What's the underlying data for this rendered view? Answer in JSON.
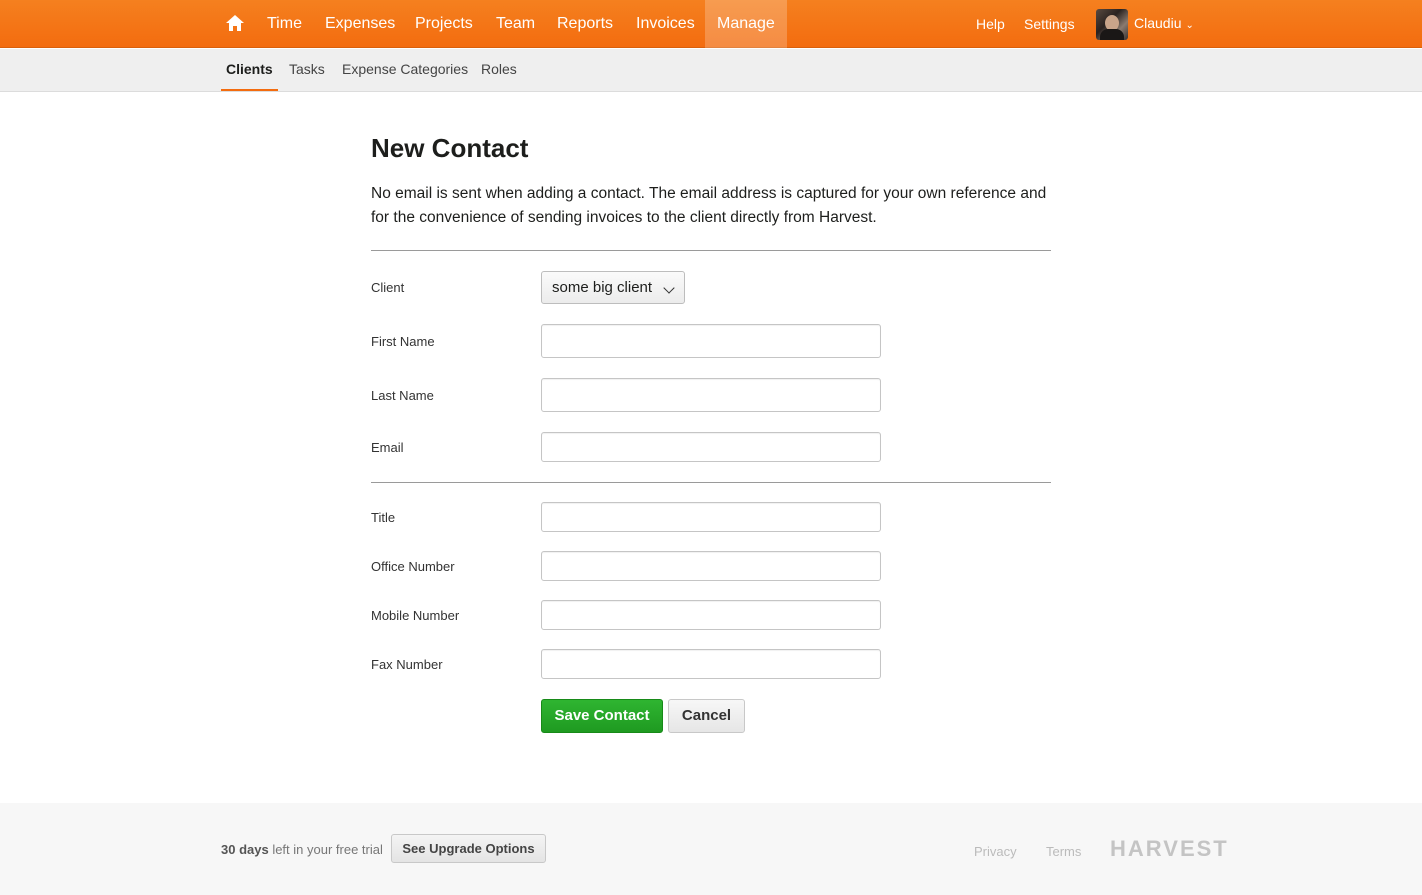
{
  "nav": {
    "items": [
      "Time",
      "Expenses",
      "Projects",
      "Team",
      "Reports",
      "Invoices",
      "Manage"
    ],
    "active": "Manage",
    "help": "Help",
    "settings": "Settings",
    "user": "Claudiu"
  },
  "subnav": {
    "items": [
      "Clients",
      "Tasks",
      "Expense Categories",
      "Roles"
    ],
    "active": "Clients"
  },
  "page": {
    "title": "New Contact",
    "description": "No email is sent when adding a contact. The email address is captured for your own reference and for the convenience of sending invoices to the client directly from Harvest."
  },
  "form": {
    "client_label": "Client",
    "client_value": "some big client",
    "first_name_label": "First Name",
    "first_name_value": "",
    "last_name_label": "Last Name",
    "last_name_value": "",
    "email_label": "Email",
    "email_value": "",
    "title_label": "Title",
    "title_value": "",
    "office_label": "Office Number",
    "office_value": "",
    "mobile_label": "Mobile Number",
    "mobile_value": "",
    "fax_label": "Fax Number",
    "fax_value": "",
    "save_label": "Save Contact",
    "cancel_label": "Cancel"
  },
  "footer": {
    "trial_days": "30 days",
    "trial_text": " left in your free trial",
    "upgrade_label": "See Upgrade Options",
    "privacy": "Privacy",
    "terms": "Terms",
    "brand": "HARVEST"
  },
  "colors": {
    "accent": "#f36c0f",
    "save": "#1f9a21"
  },
  "icons": {
    "home": "home-icon",
    "user_caret": "chevron-down-icon",
    "select_caret": "chevron-down-icon"
  }
}
